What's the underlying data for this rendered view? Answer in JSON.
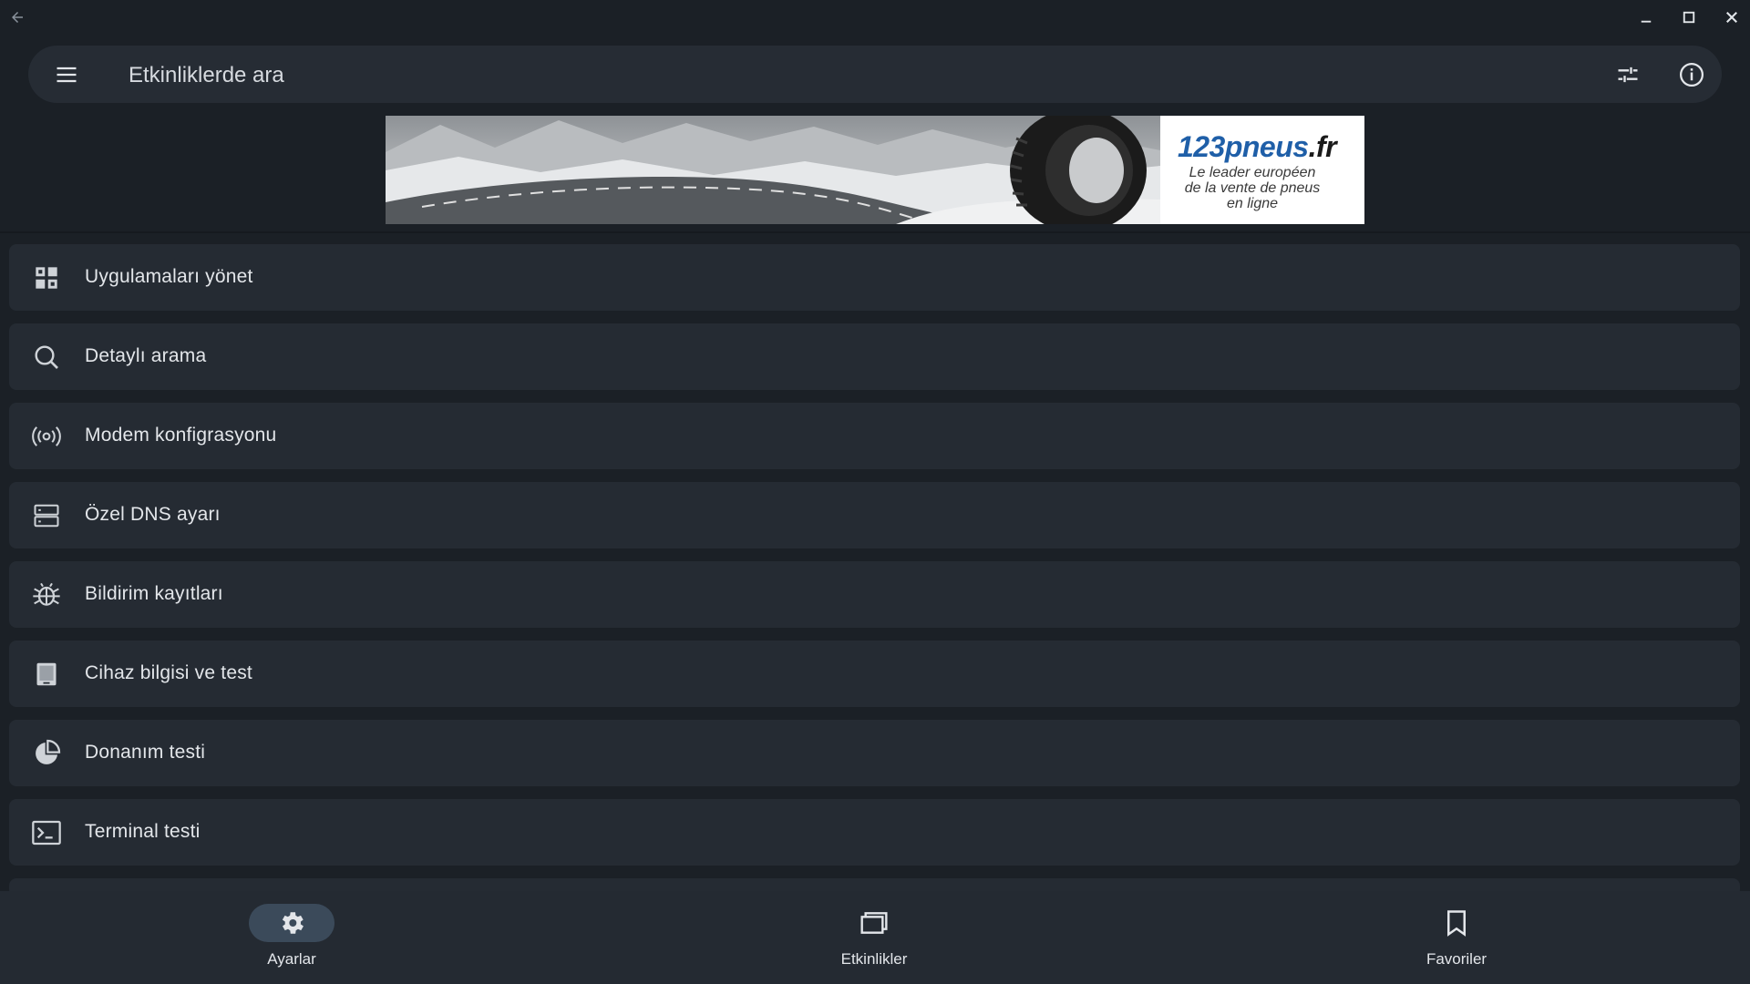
{
  "search": {
    "placeholder": "Etkinliklerde ara"
  },
  "ad": {
    "brand_main": "123pneus",
    "brand_suffix": ".fr",
    "tagline_line1": "Le leader européen",
    "tagline_line2": "de la vente de pneus",
    "tagline_line3": "en ligne"
  },
  "menu": {
    "items": [
      {
        "label": "Uygulamaları yönet",
        "icon": "apps-grid-icon"
      },
      {
        "label": "Detaylı arama",
        "icon": "search-icon"
      },
      {
        "label": "Modem konfigrasyonu",
        "icon": "hotspot-icon"
      },
      {
        "label": "Özel DNS ayarı",
        "icon": "dns-server-icon"
      },
      {
        "label": "Bildirim kayıtları",
        "icon": "bug-icon"
      },
      {
        "label": "Cihaz bilgisi ve test",
        "icon": "device-icon"
      },
      {
        "label": "Donanım testi",
        "icon": "pie-chart-icon"
      },
      {
        "label": "Terminal  testi",
        "icon": "terminal-icon"
      }
    ]
  },
  "nav": {
    "settings": "Ayarlar",
    "activities": "Etkinlikler",
    "favorites": "Favoriler"
  },
  "colors": {
    "background": "#1b2026",
    "card": "#252b33",
    "active_pill": "#3b4a5a"
  }
}
